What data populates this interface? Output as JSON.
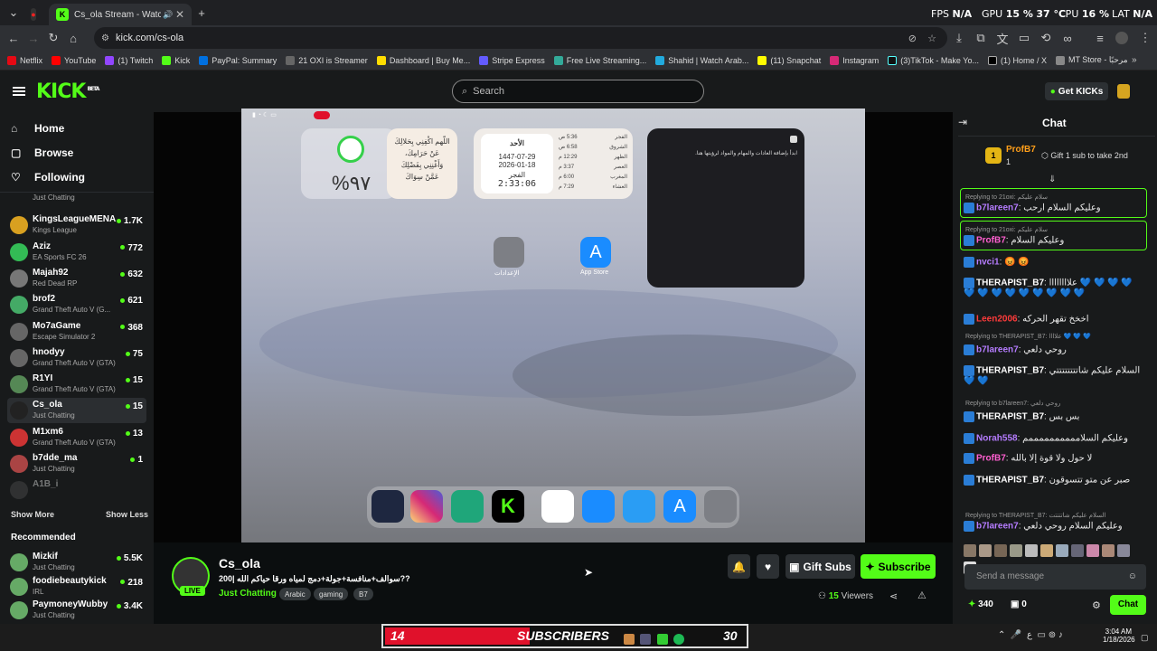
{
  "browser": {
    "tabs": [
      {
        "label": "Cs_ola Stream - Watch Live"
      }
    ],
    "perf": {
      "fps_label": "FPS",
      "fps": "N/A",
      "gpu_label": "GPU",
      "gpu": "15 %",
      "gpu_temp": "37 °C",
      "cpu_label": "CPU",
      "cpu": "16 %",
      "lat_label": "LAT",
      "lat": "N/A"
    },
    "url": "kick.com/cs-ola",
    "bookmarks": [
      "Netflix",
      "YouTube",
      "(1) Twitch",
      "Kick",
      "PayPal: Summary",
      "21 OXI is Streamer",
      "Dashboard | Buy Me...",
      "Stripe Express",
      "Free Live Streaming...",
      "Shahid | Watch Arab...",
      "(11) Snapchat",
      "Instagram",
      "(3)TikTok - Make Yo...",
      "(1) Home / X",
      "MT Store - مرحبًا"
    ]
  },
  "header": {
    "logo": "KICK",
    "logo_sup": "BETA",
    "search_placeholder": "Search",
    "get_kicks": "Get KICKs"
  },
  "nav": {
    "home": "Home",
    "browse": "Browse",
    "following": "Following"
  },
  "following": [
    {
      "name": "",
      "category": "Just Chatting",
      "viewers": ""
    },
    {
      "name": "KingsLeagueMENA",
      "category": "Kings League",
      "viewers": "1.7K"
    },
    {
      "name": "Aziz",
      "category": "EA Sports FC 26",
      "viewers": "772"
    },
    {
      "name": "Majah92",
      "category": "Red Dead RP",
      "viewers": "632"
    },
    {
      "name": "brof2",
      "category": "Grand Theft Auto V (G...",
      "viewers": "621"
    },
    {
      "name": "Mo7aGame",
      "category": "Escape Simulator 2",
      "viewers": "368"
    },
    {
      "name": "hnodyy",
      "category": "Grand Theft Auto V (GTA)",
      "viewers": "75"
    },
    {
      "name": "R1YI",
      "category": "Grand Theft Auto V (GTA)",
      "viewers": "15"
    },
    {
      "name": "Cs_ola",
      "category": "Just Chatting",
      "viewers": "15"
    },
    {
      "name": "M1xm6",
      "category": "Grand Theft Auto V (GTA)",
      "viewers": "13"
    },
    {
      "name": "b7dde_ma",
      "category": "Just Chatting",
      "viewers": "1"
    },
    {
      "name": "A1B_i",
      "category": "",
      "viewers": ""
    }
  ],
  "show_more": "Show More",
  "show_less": "Show Less",
  "recommended_title": "Recommended",
  "recommended": [
    {
      "name": "Mizkif",
      "category": "Just Chatting",
      "viewers": "5.5K"
    },
    {
      "name": "foodiebeautykick",
      "category": "IRL",
      "viewers": "218"
    },
    {
      "name": "PaymoneyWubby",
      "category": "Just Chatting",
      "viewers": "3.4K"
    }
  ],
  "stream_screen": {
    "battery": "%٩٧",
    "dua": "اللّهم اكْفِنِي بِحَلالِكَ عَنْ حَرَامِكَ، وَأَغْنِنِي بِفَضْلِكَ عَمَّنْ سِوَاكَ",
    "prayer_day": "الأحد",
    "hijri": "1447-07-29",
    "greg": "2026-01-18",
    "next_prayer": "الفجر",
    "countdown": "2:33:06",
    "prayers": [
      {
        "name": "الفجر",
        "time": "5:36 ص"
      },
      {
        "name": "الشروق",
        "time": "6:58 ص"
      },
      {
        "name": "الظهر",
        "time": "12:29 م"
      },
      {
        "name": "العصر",
        "time": "3:37 م"
      },
      {
        "name": "المغرب",
        "time": "6:00 م"
      },
      {
        "name": "العشاء",
        "time": "7:29 م"
      }
    ],
    "notes_text": "ابدأ بإضافة العادات والمهام والمواد لرؤيتها هنا.",
    "settings_label": "الإعدادات",
    "appstore_label": "App Store"
  },
  "stream": {
    "streamer": "Cs_ola",
    "live": "LIVE",
    "title": "200| سوالف+منافسة+جولة+دمج لمياه ورقا حياكم الله??",
    "category": "Just Chatting",
    "tags": [
      "Arabic",
      "gaming",
      "B7"
    ],
    "gift_subs": "Gift Subs",
    "subscribe": "Subscribe",
    "viewers": "15",
    "viewers_label": "Viewers"
  },
  "chat": {
    "title": "Chat",
    "pinned_user": "ProfB7",
    "pinned_count": "1",
    "pinned_text": "Gift 1 sub to take 2nd",
    "placeholder": "Send a message",
    "points": "340",
    "tickets": "0",
    "send": "Chat",
    "messages": [
      {
        "reply": "Replying to 21oxi: سلام عليكم",
        "user": "b7lareen7",
        "color": "#b57cff",
        "text": "وعليكم السلام ارحب",
        "highlight": true
      },
      {
        "reply": "Replying to 21oxi: سلام عليكم",
        "user": "ProfB7",
        "color": "#ff5fd0",
        "text": "وعليكم السلام",
        "highlight": true
      },
      {
        "reply": "",
        "user": "nvci1",
        "color": "#b57cff",
        "text": "😡 😡"
      },
      {
        "reply": "",
        "user": "THERAPIST_B7",
        "color": "#ffffff",
        "text": "علاااااااا 💙 💙 💙 💙 💙 💙 💙 💙 💙 💙 💙 💙 💙"
      },
      {
        "reply": "",
        "user": "Leen2006",
        "color": "#ff3b3b",
        "text": "اخخخ تقهر الحركه"
      },
      {
        "reply": "Replying to THERAPIST_B7: علاااا 💙 💙 💙",
        "user": "b7lareen7",
        "color": "#b57cff",
        "text": "روحي دلعي"
      },
      {
        "reply": "",
        "user": "THERAPIST_B7",
        "color": "#ffffff",
        "text": "السلام عليكم شاتتتتتتتتي 💙 💙"
      },
      {
        "reply": "Replying to b7lareen7: روحي دلعي",
        "user": "THERAPIST_B7",
        "color": "#ffffff",
        "text": "بس بس"
      },
      {
        "reply": "",
        "user": "Norah558",
        "color": "#b57cff",
        "text": "وعليكم السلاممممممممممم"
      },
      {
        "reply": "",
        "user": "ProfB7",
        "color": "#ff5fd0",
        "text": "لا حول ولا قوة إلا بالله"
      },
      {
        "reply": "",
        "user": "THERAPIST_B7",
        "color": "#ffffff",
        "text": "صبر عن متو تتسوقون"
      },
      {
        "reply": "Replying to THERAPIST_B7: السلام عليكم شاتتتتت",
        "user": "b7lareen7",
        "color": "#b57cff",
        "text": "وعليكم السلام روحي دلعي"
      }
    ]
  },
  "overlay": {
    "left_num": "14",
    "label": "SUBSCRIBERS",
    "right_num": "30",
    "progress": 0.4
  },
  "taskbar": {
    "time": "3:04 AM",
    "date": "1/18/2026"
  }
}
